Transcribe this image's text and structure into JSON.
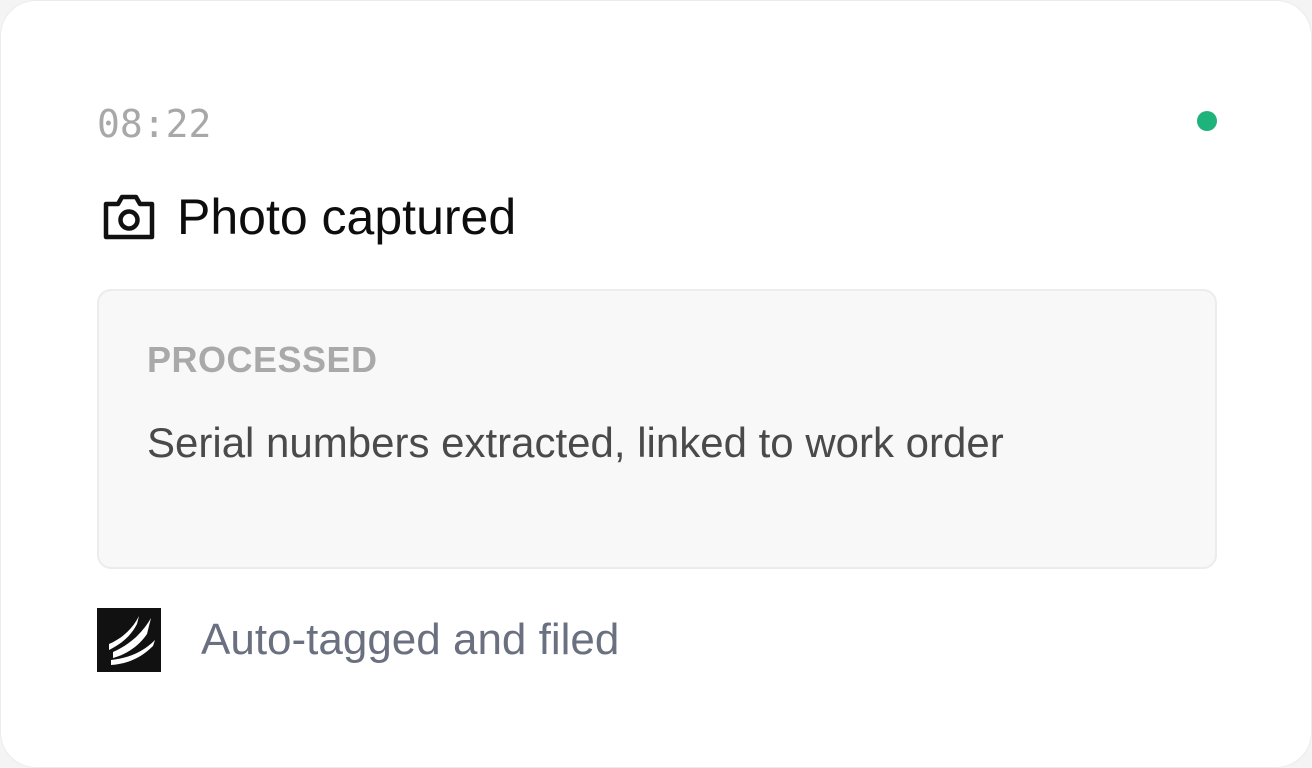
{
  "card": {
    "time": "08:22",
    "status_color": "#1fb37c",
    "event": {
      "icon": "camera-icon",
      "title": "Photo captured"
    },
    "detail": {
      "label": "PROCESSED",
      "text": "Serial numbers extracted, linked to work order"
    },
    "footer": {
      "logo": "brand-logo",
      "text": "Auto-tagged and filed"
    }
  }
}
